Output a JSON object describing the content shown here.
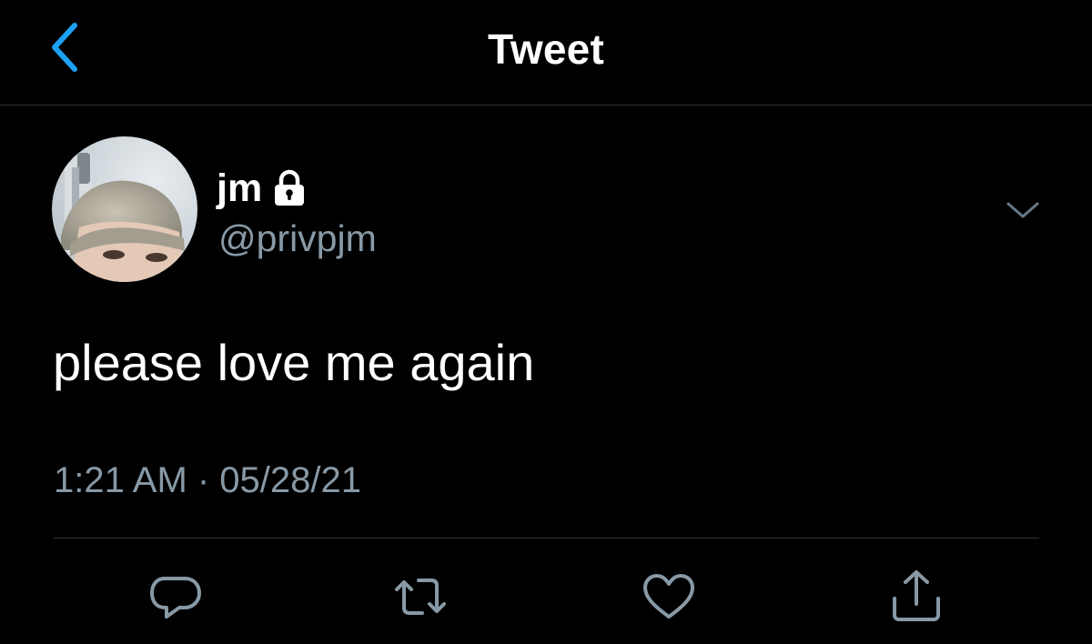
{
  "header": {
    "title": "Tweet",
    "back_icon": "chevron-left-icon",
    "accent_color": "#1da1f2"
  },
  "tweet": {
    "display_name": "jm",
    "protected_icon": "lock-icon",
    "handle": "@privpjm",
    "text": "please love me again",
    "timestamp": "1:21 AM · 05/28/21",
    "menu_icon": "chevron-down-icon"
  },
  "actions": [
    {
      "name": "reply",
      "icon": "comment-icon"
    },
    {
      "name": "retweet",
      "icon": "retweet-icon"
    },
    {
      "name": "like",
      "icon": "heart-icon"
    },
    {
      "name": "share",
      "icon": "share-icon"
    }
  ],
  "colors": {
    "background": "#000000",
    "primary_text": "#ffffff",
    "secondary_text": "#8899a6",
    "divider": "#2f3336",
    "icon": "#8899a6"
  }
}
